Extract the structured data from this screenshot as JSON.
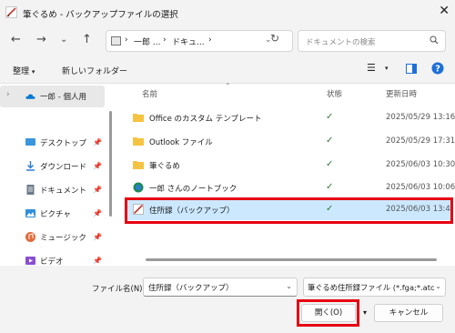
{
  "window": {
    "title": "筆ぐるめ - バックアップファイルの選択"
  },
  "address": {
    "crumbs": [
      "一郎 ...",
      "ドキュ..."
    ]
  },
  "search": {
    "placeholder": "ドキュメントの検索"
  },
  "toolbar": {
    "organize": "整理",
    "new_folder": "新しいフォルダー"
  },
  "sidebar": {
    "items": [
      {
        "label": "一郎 - 個人用",
        "icon": "onedrive-cloud-icon",
        "color": "#0078d4"
      },
      {
        "label": "デスクトップ",
        "icon": "desktop-icon",
        "color": "#3a96dd"
      },
      {
        "label": "ダウンロード",
        "icon": "download-icon",
        "color": "#2b7bd4"
      },
      {
        "label": "ドキュメント",
        "icon": "document-icon",
        "color": "#6d7a8a"
      },
      {
        "label": "ピクチャ",
        "icon": "pictures-icon",
        "color": "#2f8fd8"
      },
      {
        "label": "ミュージック",
        "icon": "music-icon",
        "color": "#e06a3a"
      },
      {
        "label": "ビデオ",
        "icon": "video-icon",
        "color": "#8a4fd0"
      }
    ]
  },
  "columns": {
    "name": "名前",
    "status": "状態",
    "modified": "更新日時"
  },
  "files": [
    {
      "name": "Office のカスタム テンプレート",
      "type": "folder",
      "status": "synced",
      "modified": "2025/05/29 13:16"
    },
    {
      "name": "Outlook ファイル",
      "type": "folder",
      "status": "synced",
      "modified": "2025/05/29 17:31"
    },
    {
      "name": "筆ぐるめ",
      "type": "folder",
      "status": "synced",
      "modified": "2025/06/03 10:30"
    },
    {
      "name": "一郎 さんのノートブック",
      "type": "onenote",
      "status": "synced",
      "modified": "2025/06/03 10:06"
    },
    {
      "name": "住所録（バックアップ）",
      "type": "fudegurume-file",
      "status": "synced",
      "modified": "2025/06/03 13:4",
      "selected": true
    }
  ],
  "footer": {
    "filename_label": "ファイル名(N):",
    "filename_value": "住所録（バックアップ）",
    "filetype_value": "筆ぐるめ住所録ファイル (*.fga;*.atc",
    "open_label": "開く(O)",
    "cancel_label": "キャンセル"
  },
  "colors": {
    "selection": "#cce8ff",
    "highlight": "#e60012",
    "folder": "#f5c342",
    "check": "#2e7d32"
  }
}
